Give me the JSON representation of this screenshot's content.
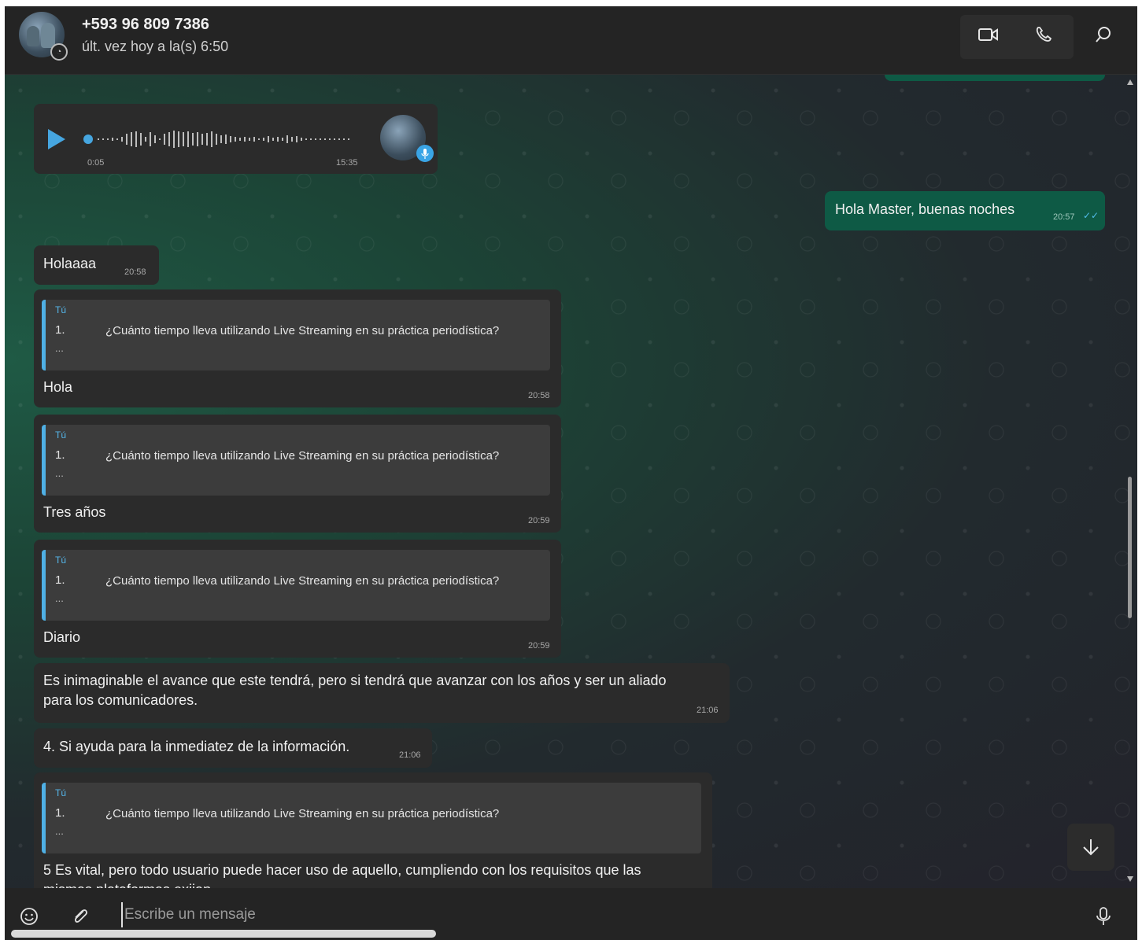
{
  "header": {
    "contact_name": "+593 96 809 7386",
    "last_seen": "últ. vez hoy a la(s) 6:50"
  },
  "messages": {
    "voice_note": {
      "elapsed": "0:05",
      "time": "15:35"
    },
    "out_1": {
      "text": "Hola Master, buenas noches",
      "time": "20:57"
    },
    "in_1": {
      "text": "Holaaaa",
      "time": "20:58"
    },
    "reply_1": {
      "quote_author": "Tú",
      "quote_number": "1.",
      "quote_text": "¿Cuánto tiempo lleva utilizando Live Streaming en su práctica periodística?",
      "quote_more": "...",
      "text": "Hola",
      "time": "20:58"
    },
    "reply_2": {
      "quote_author": "Tú",
      "quote_number": "1.",
      "quote_text": "¿Cuánto tiempo lleva utilizando Live Streaming en su práctica periodística?",
      "quote_more": "...",
      "text": "Tres años",
      "time": "20:59"
    },
    "reply_3": {
      "quote_author": "Tú",
      "quote_number": "1.",
      "quote_text": "¿Cuánto tiempo lleva utilizando Live Streaming en su práctica periodística?",
      "quote_more": "...",
      "text": "Diario",
      "time": "20:59"
    },
    "in_2": {
      "text_line1": "Es inimaginable el avance que este tendrá, pero si tendrá que avanzar con los años y ser un aliado",
      "text_line2": "para los comunicadores.",
      "time": "21:06"
    },
    "in_3": {
      "text": "4. Si ayuda para la inmediatez de la información.",
      "time": "21:06"
    },
    "reply_4": {
      "quote_author": "Tú",
      "quote_number": "1.",
      "quote_text": "¿Cuánto tiempo lleva utilizando Live Streaming en su práctica periodística?",
      "quote_more": "...",
      "text_line1": "5 Es vital, pero todo usuario puede hacer uso de aquello, cumpliendo con los requisitos que las",
      "text_line2": "mismas plataformas exijan."
    }
  },
  "composer": {
    "placeholder": "Escribe un mensaje"
  },
  "icons": {
    "video": "video-camera-icon",
    "call": "phone-icon",
    "search": "search-icon",
    "emoji": "emoji-icon",
    "attach": "paperclip-icon",
    "mic": "microphone-icon",
    "scroll_down": "arrow-down-icon"
  },
  "colors": {
    "outgoing_bubble": "#0e5a45",
    "incoming_bubble": "#2b2b2b",
    "quote_accent": "#4fb0e5",
    "header_bg": "#242424"
  }
}
